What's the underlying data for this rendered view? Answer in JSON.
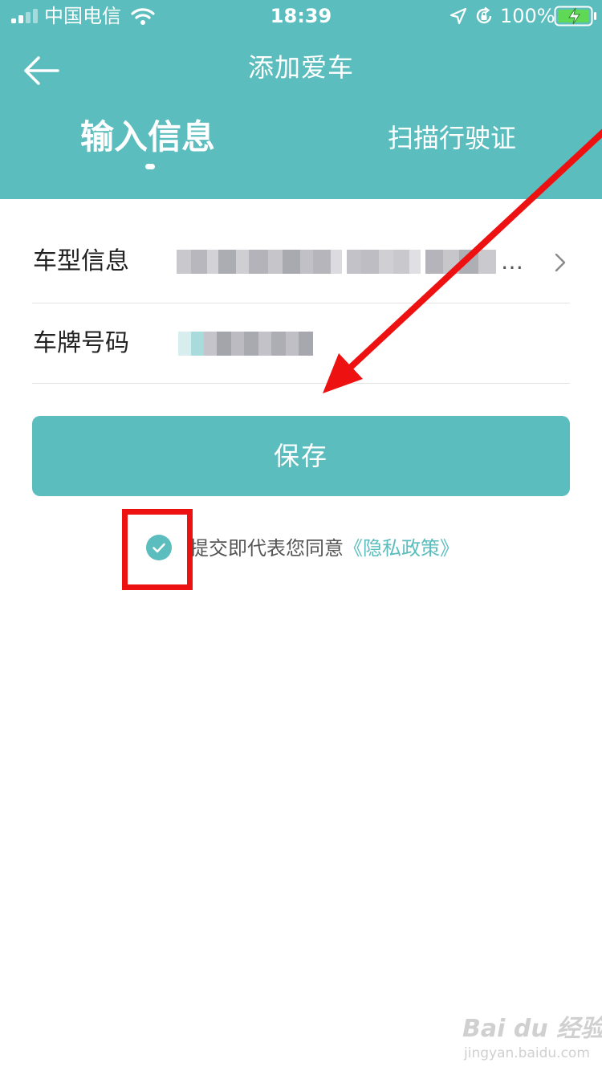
{
  "colors": {
    "accent": "#5bbdbd",
    "annotation": "#ee1111"
  },
  "status_bar": {
    "carrier": "中国电信",
    "time": "18:39",
    "battery": "100%"
  },
  "nav": {
    "title": "添加爱车",
    "back_icon": "back-arrow-icon"
  },
  "tabs": [
    {
      "label": "输入信息",
      "active": true
    },
    {
      "label": "扫描行驶证",
      "active": false
    }
  ],
  "form": {
    "model": {
      "label": "车型信息",
      "ellipsis": "…"
    },
    "plate": {
      "label": "车牌号码"
    }
  },
  "save_label": "保存",
  "agreement": {
    "checked": true,
    "text": "提交即代表您同意",
    "link": "《隐私政策》"
  },
  "watermark": {
    "logo": "Bai du 经验",
    "url": "jingyan.baidu.com"
  }
}
